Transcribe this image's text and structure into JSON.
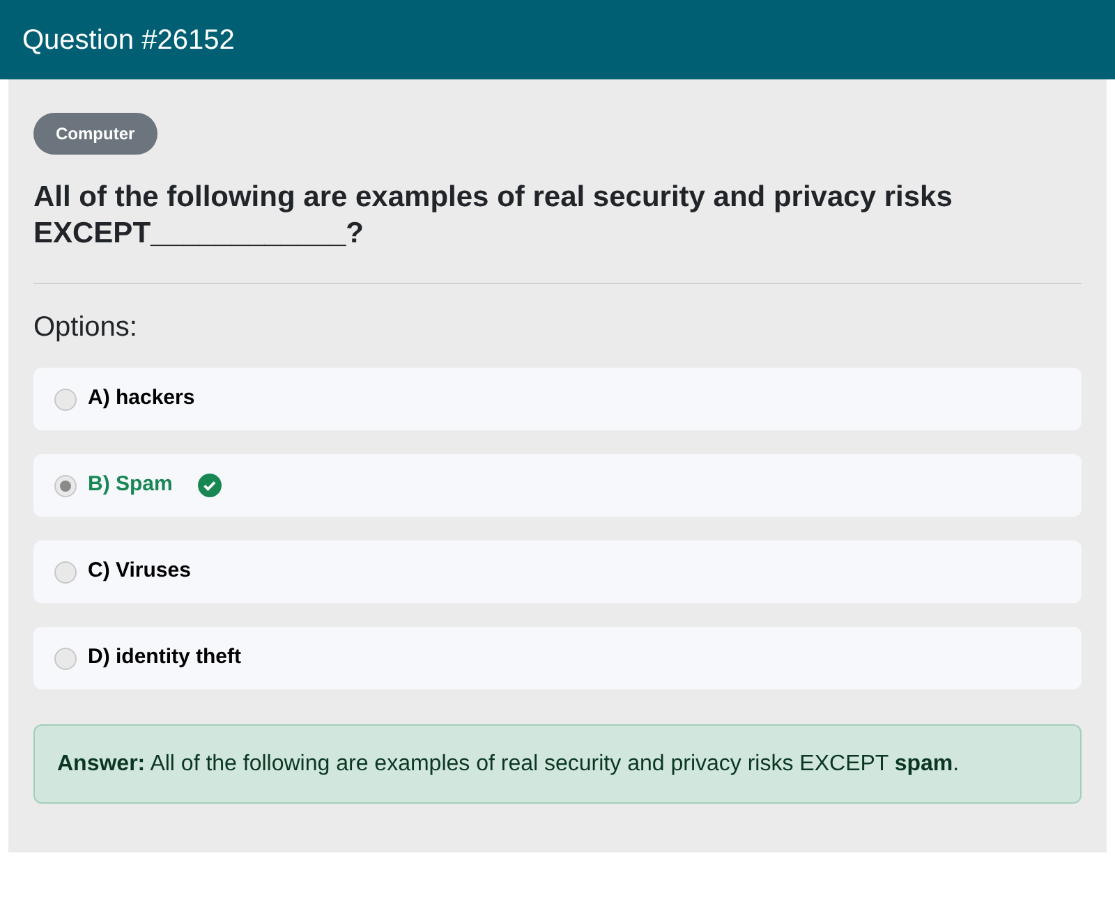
{
  "header": {
    "title": "Question #26152"
  },
  "category": "Computer",
  "question": "All of the following are examples of real security and privacy risks EXCEPT____________?",
  "options_heading": "Options:",
  "options": [
    {
      "label": "A) hackers",
      "selected": false,
      "correct": false
    },
    {
      "label": "B) Spam",
      "selected": true,
      "correct": true
    },
    {
      "label": "C) Viruses",
      "selected": false,
      "correct": false
    },
    {
      "label": "D) identity theft",
      "selected": false,
      "correct": false
    }
  ],
  "answer": "**Answer:** All of the following are examples of real security and privacy risks EXCEPT **spam**."
}
